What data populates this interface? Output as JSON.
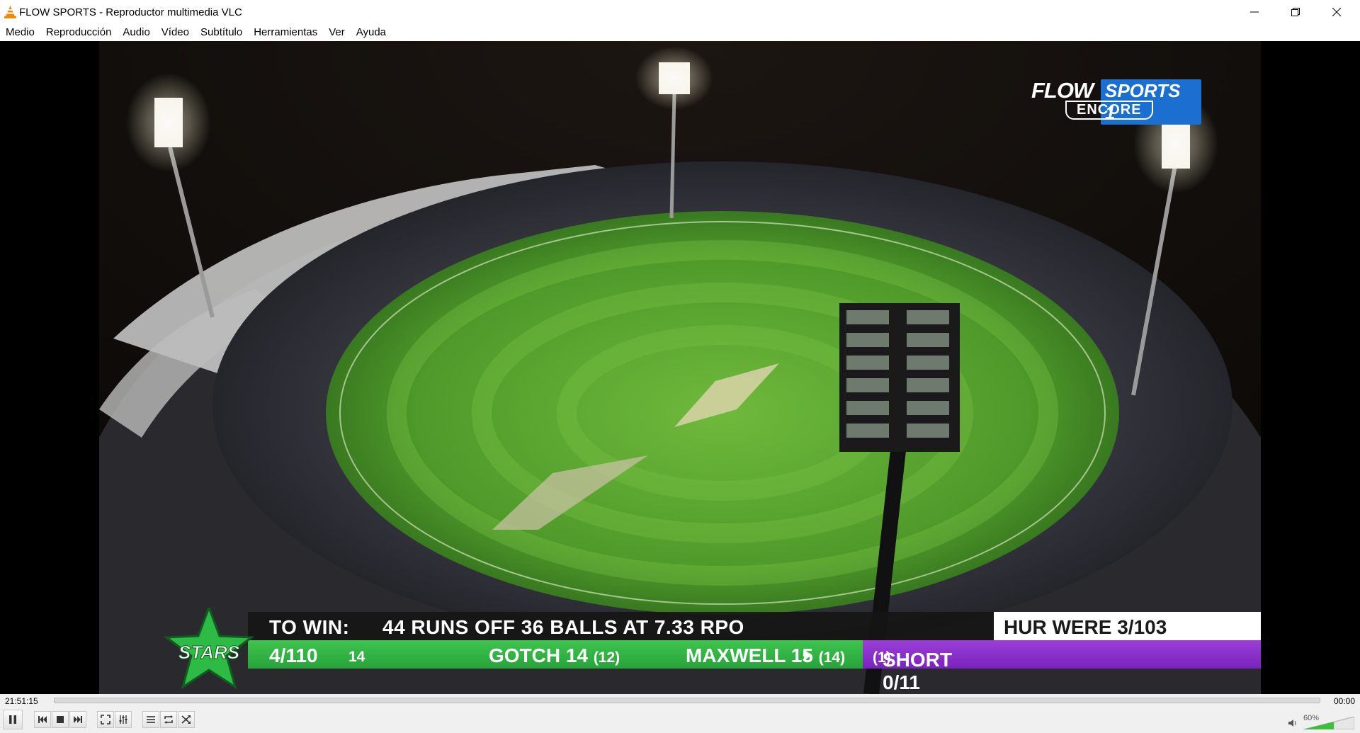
{
  "window": {
    "title": "FLOW SPORTS - Reproductor multimedia VLC",
    "controls": [
      "minimize-icon",
      "restore-icon",
      "close-icon"
    ]
  },
  "menu": [
    "Medio",
    "Reproducción",
    "Audio",
    "Vídeo",
    "Subtítulo",
    "Herramientas",
    "Ver",
    "Ayuda"
  ],
  "video": {
    "channel_logo": {
      "brand": "FLOW",
      "channel": "SPORTS 1",
      "tag": "ENCORE"
    },
    "team_logo_text": "STARS",
    "scoreboard": {
      "to_win_label": "TO WIN:",
      "to_win_text": "44 RUNS OFF 36 BALLS AT 7.33 RPO",
      "opponent": "HUR WERE 3/103",
      "score": "4/110",
      "overs": "14",
      "batsman1_name": "GOTCH 14",
      "batsman1_balls": "(12)",
      "batsman2_name": "MAXWELL 15",
      "batsman2_balls": "(14)",
      "bowler_name": "SHORT 0/11",
      "bowler_overs": "(1)"
    }
  },
  "playback": {
    "elapsed": "21:51:15",
    "remaining": "00:00",
    "progress": 0.0,
    "volume_label": "60%",
    "volume": 0.6
  },
  "colors": {
    "accent_green": "#2fb142",
    "accent_purple": "#8a2fcc",
    "vlc_orange": "#f08a00"
  }
}
